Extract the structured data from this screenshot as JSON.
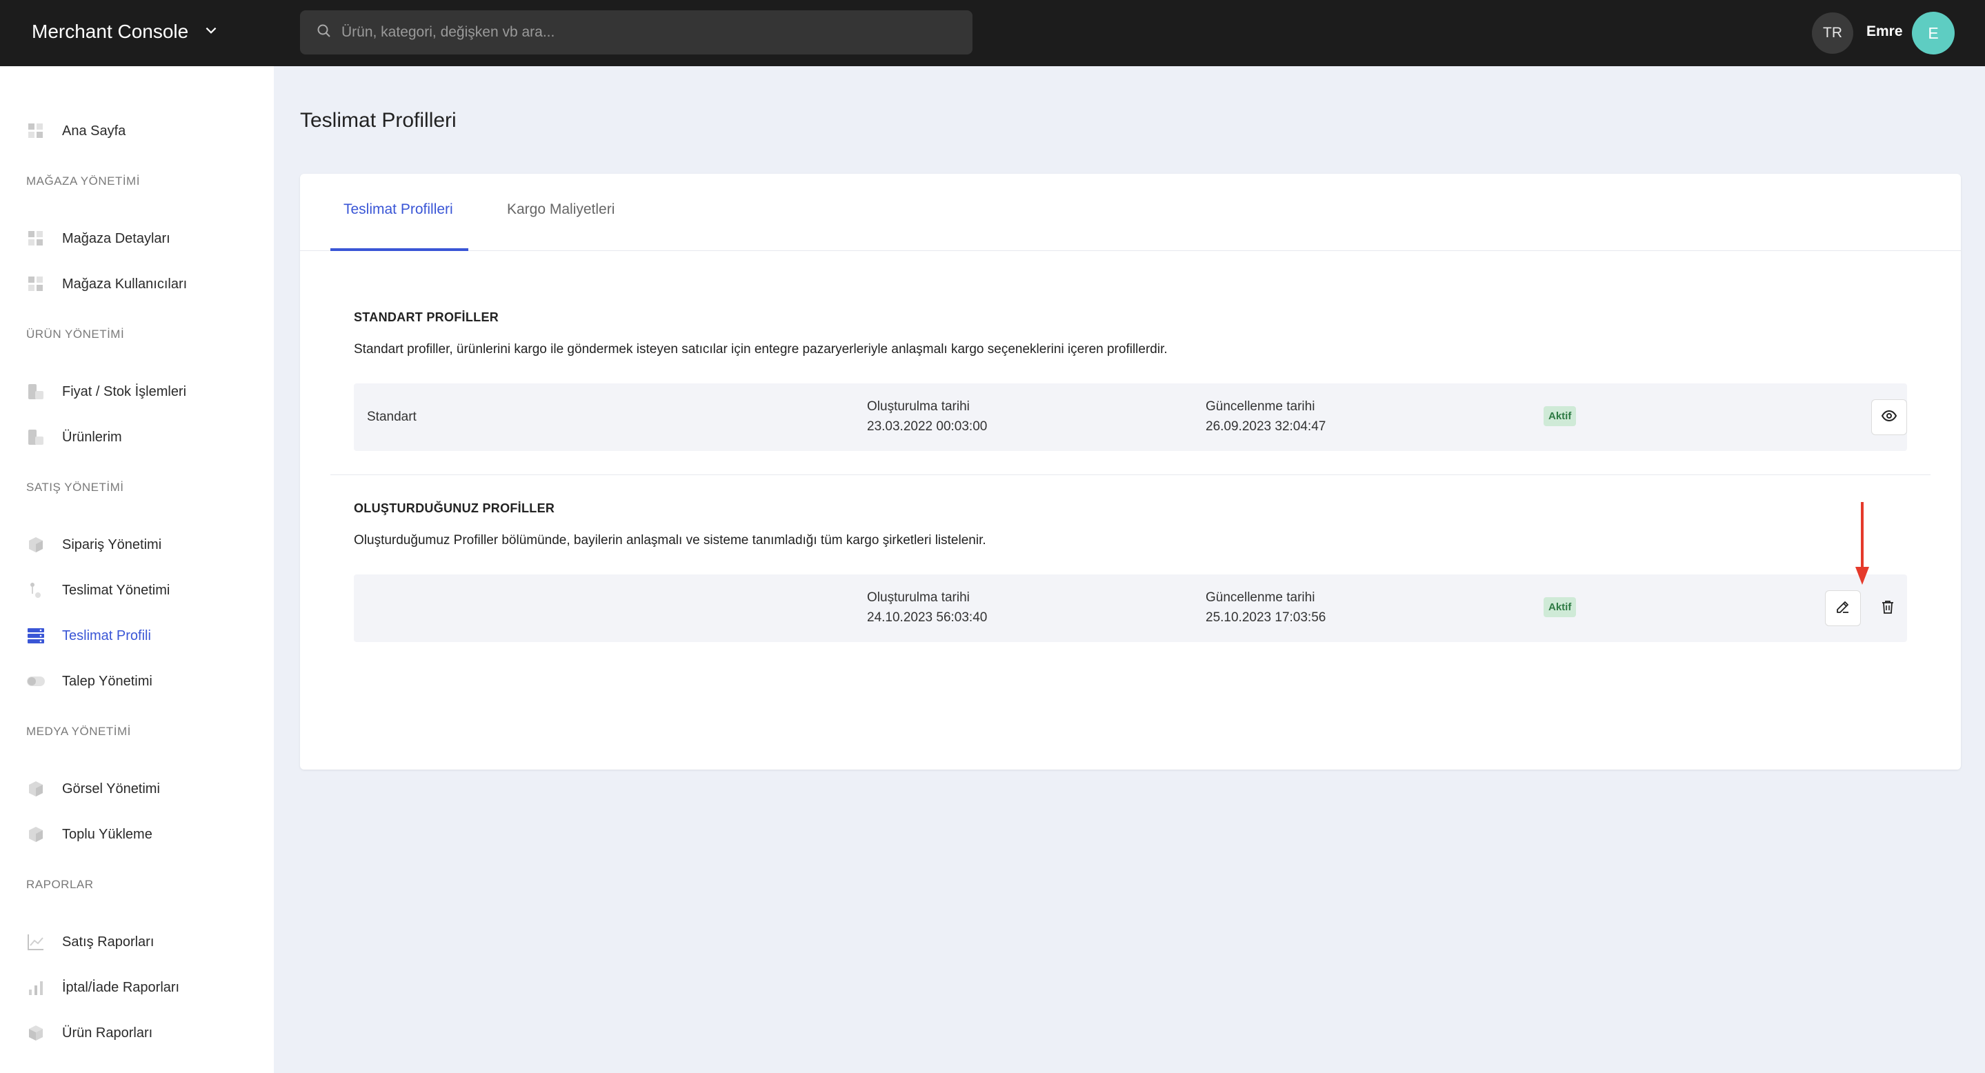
{
  "header": {
    "app_title": "Merchant Console",
    "search_placeholder": "Ürün, kategori, değişken vb ara...",
    "language": "TR",
    "user_name": "Emre",
    "avatar_initial": "E",
    "avatar_color": "#5ecdc2"
  },
  "sidebar": {
    "home": "Ana Sayfa",
    "sections": {
      "store": "MAĞAZA YÖNETİMİ",
      "product": "ÜRÜN YÖNETİMİ",
      "sales": "SATIŞ YÖNETİMİ",
      "media": "MEDYA YÖNETİMİ",
      "reports": "RAPORLAR"
    },
    "items": {
      "store_details": "Mağaza Detayları",
      "store_users": "Mağaza Kullanıcıları",
      "price_stock": "Fiyat / Stok İşlemleri",
      "my_products": "Ürünlerim",
      "orders": "Sipariş Yönetimi",
      "delivery_mgmt": "Teslimat Yönetimi",
      "delivery_profile": "Teslimat Profili",
      "requests": "Talep Yönetimi",
      "images": "Görsel Yönetimi",
      "bulk_upload": "Toplu Yükleme",
      "sales_reports": "Satış Raporları",
      "cancel_return_reports": "İptal/İade Raporları",
      "product_reports": "Ürün Raporları"
    },
    "active_item": "delivery_profile",
    "accent_color": "#3a56d6"
  },
  "main": {
    "page_title": "Teslimat Profilleri",
    "tabs": {
      "delivery_profiles": "Teslimat Profilleri",
      "cargo_costs": "Kargo Maliyetleri"
    },
    "active_tab": "delivery_profiles",
    "standard": {
      "title": "STANDART PROFİLLER",
      "description": "Standart profiller, ürünlerini kargo ile göndermek isteyen satıcılar için entegre pazaryerleriyle anlaşmalı kargo seçeneklerini içeren profillerdir.",
      "row": {
        "name": "Standart",
        "created_label": "Oluşturulma tarihi",
        "created_value": "23.03.2022 00:03:00",
        "updated_label": "Güncellenme tarihi",
        "updated_value": "26.09.2023 32:04:47",
        "status": "Aktif",
        "action_icon": "eye-icon"
      }
    },
    "custom": {
      "title": "OLUŞTURDUĞUNUZ PROFİLLER",
      "description": "Oluşturduğumuz Profiller bölümünde, bayilerin anlaşmalı ve sisteme tanımladığı tüm kargo şirketleri listelenir.",
      "row": {
        "name": "",
        "created_label": "Oluşturulma tarihi",
        "created_value": "24.10.2023 56:03:40",
        "updated_label": "Güncellenme tarihi",
        "updated_value": "25.10.2023 17:03:56",
        "status": "Aktif",
        "action_icons": [
          "edit-icon",
          "trash-icon"
        ]
      }
    },
    "annotation_arrow_color": "#e53a2b"
  }
}
